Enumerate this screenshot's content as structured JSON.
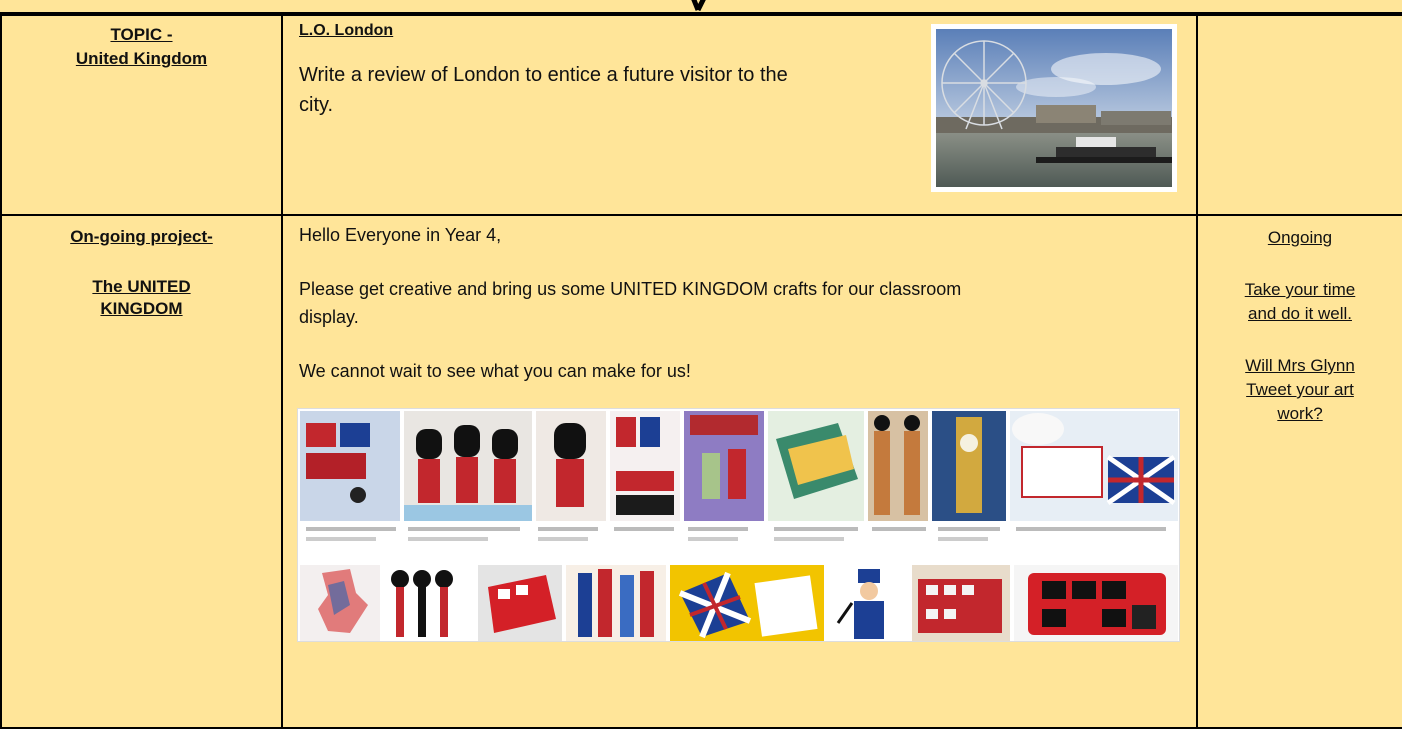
{
  "topic_row": {
    "label_line1": "TOPIC -",
    "label_line2": "United Kingdom",
    "objective": "L.O. London",
    "task": "Write a review of London to entice a future visitor to the city.",
    "photo_icon": "london-eye-photo"
  },
  "project_row": {
    "label_line1": "On-going project-",
    "label_line2": "The UNITED",
    "label_line3": "KINGDOM",
    "greeting": "Hello Everyone in Year 4,",
    "request_line1": "Please get creative and bring us some UNITED KINGDOM crafts for our classroom",
    "request_line2": "display.",
    "closing": "We cannot wait to see what you can make for us!",
    "status": "Ongoing",
    "note_line1": "Take your time",
    "note_line2": "and do it well.",
    "question_line1": "Will Mrs Glynn",
    "question_line2": "Tweet your art",
    "question_line3": "work?",
    "crafts_icon": "uk-crafts-collage"
  },
  "colors": {
    "cell_background": "#ffe599",
    "border": "#000000",
    "bus_red": "#d42027",
    "flag_blue": "#1c3f94"
  }
}
